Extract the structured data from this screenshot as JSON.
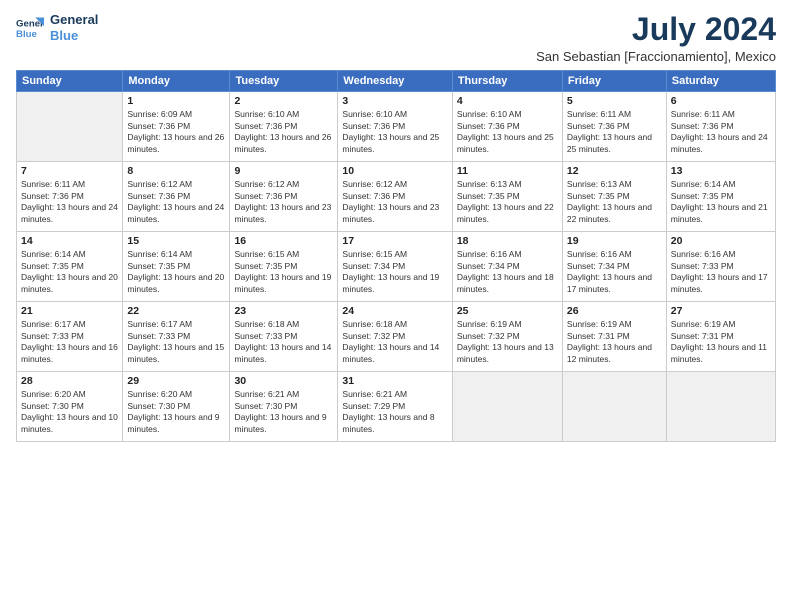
{
  "header": {
    "logo_line1": "General",
    "logo_line2": "Blue",
    "title": "July 2024",
    "subtitle": "San Sebastian [Fraccionamiento], Mexico"
  },
  "calendar": {
    "days_of_week": [
      "Sunday",
      "Monday",
      "Tuesday",
      "Wednesday",
      "Thursday",
      "Friday",
      "Saturday"
    ],
    "weeks": [
      [
        {
          "day": "",
          "sunrise": "",
          "sunset": "",
          "daylight": "",
          "empty": true
        },
        {
          "day": "1",
          "sunrise": "Sunrise: 6:09 AM",
          "sunset": "Sunset: 7:36 PM",
          "daylight": "Daylight: 13 hours and 26 minutes.",
          "empty": false
        },
        {
          "day": "2",
          "sunrise": "Sunrise: 6:10 AM",
          "sunset": "Sunset: 7:36 PM",
          "daylight": "Daylight: 13 hours and 26 minutes.",
          "empty": false
        },
        {
          "day": "3",
          "sunrise": "Sunrise: 6:10 AM",
          "sunset": "Sunset: 7:36 PM",
          "daylight": "Daylight: 13 hours and 25 minutes.",
          "empty": false
        },
        {
          "day": "4",
          "sunrise": "Sunrise: 6:10 AM",
          "sunset": "Sunset: 7:36 PM",
          "daylight": "Daylight: 13 hours and 25 minutes.",
          "empty": false
        },
        {
          "day": "5",
          "sunrise": "Sunrise: 6:11 AM",
          "sunset": "Sunset: 7:36 PM",
          "daylight": "Daylight: 13 hours and 25 minutes.",
          "empty": false
        },
        {
          "day": "6",
          "sunrise": "Sunrise: 6:11 AM",
          "sunset": "Sunset: 7:36 PM",
          "daylight": "Daylight: 13 hours and 24 minutes.",
          "empty": false
        }
      ],
      [
        {
          "day": "7",
          "sunrise": "Sunrise: 6:11 AM",
          "sunset": "Sunset: 7:36 PM",
          "daylight": "Daylight: 13 hours and 24 minutes.",
          "empty": false
        },
        {
          "day": "8",
          "sunrise": "Sunrise: 6:12 AM",
          "sunset": "Sunset: 7:36 PM",
          "daylight": "Daylight: 13 hours and 24 minutes.",
          "empty": false
        },
        {
          "day": "9",
          "sunrise": "Sunrise: 6:12 AM",
          "sunset": "Sunset: 7:36 PM",
          "daylight": "Daylight: 13 hours and 23 minutes.",
          "empty": false
        },
        {
          "day": "10",
          "sunrise": "Sunrise: 6:12 AM",
          "sunset": "Sunset: 7:36 PM",
          "daylight": "Daylight: 13 hours and 23 minutes.",
          "empty": false
        },
        {
          "day": "11",
          "sunrise": "Sunrise: 6:13 AM",
          "sunset": "Sunset: 7:35 PM",
          "daylight": "Daylight: 13 hours and 22 minutes.",
          "empty": false
        },
        {
          "day": "12",
          "sunrise": "Sunrise: 6:13 AM",
          "sunset": "Sunset: 7:35 PM",
          "daylight": "Daylight: 13 hours and 22 minutes.",
          "empty": false
        },
        {
          "day": "13",
          "sunrise": "Sunrise: 6:14 AM",
          "sunset": "Sunset: 7:35 PM",
          "daylight": "Daylight: 13 hours and 21 minutes.",
          "empty": false
        }
      ],
      [
        {
          "day": "14",
          "sunrise": "Sunrise: 6:14 AM",
          "sunset": "Sunset: 7:35 PM",
          "daylight": "Daylight: 13 hours and 20 minutes.",
          "empty": false
        },
        {
          "day": "15",
          "sunrise": "Sunrise: 6:14 AM",
          "sunset": "Sunset: 7:35 PM",
          "daylight": "Daylight: 13 hours and 20 minutes.",
          "empty": false
        },
        {
          "day": "16",
          "sunrise": "Sunrise: 6:15 AM",
          "sunset": "Sunset: 7:35 PM",
          "daylight": "Daylight: 13 hours and 19 minutes.",
          "empty": false
        },
        {
          "day": "17",
          "sunrise": "Sunrise: 6:15 AM",
          "sunset": "Sunset: 7:34 PM",
          "daylight": "Daylight: 13 hours and 19 minutes.",
          "empty": false
        },
        {
          "day": "18",
          "sunrise": "Sunrise: 6:16 AM",
          "sunset": "Sunset: 7:34 PM",
          "daylight": "Daylight: 13 hours and 18 minutes.",
          "empty": false
        },
        {
          "day": "19",
          "sunrise": "Sunrise: 6:16 AM",
          "sunset": "Sunset: 7:34 PM",
          "daylight": "Daylight: 13 hours and 17 minutes.",
          "empty": false
        },
        {
          "day": "20",
          "sunrise": "Sunrise: 6:16 AM",
          "sunset": "Sunset: 7:33 PM",
          "daylight": "Daylight: 13 hours and 17 minutes.",
          "empty": false
        }
      ],
      [
        {
          "day": "21",
          "sunrise": "Sunrise: 6:17 AM",
          "sunset": "Sunset: 7:33 PM",
          "daylight": "Daylight: 13 hours and 16 minutes.",
          "empty": false
        },
        {
          "day": "22",
          "sunrise": "Sunrise: 6:17 AM",
          "sunset": "Sunset: 7:33 PM",
          "daylight": "Daylight: 13 hours and 15 minutes.",
          "empty": false
        },
        {
          "day": "23",
          "sunrise": "Sunrise: 6:18 AM",
          "sunset": "Sunset: 7:33 PM",
          "daylight": "Daylight: 13 hours and 14 minutes.",
          "empty": false
        },
        {
          "day": "24",
          "sunrise": "Sunrise: 6:18 AM",
          "sunset": "Sunset: 7:32 PM",
          "daylight": "Daylight: 13 hours and 14 minutes.",
          "empty": false
        },
        {
          "day": "25",
          "sunrise": "Sunrise: 6:19 AM",
          "sunset": "Sunset: 7:32 PM",
          "daylight": "Daylight: 13 hours and 13 minutes.",
          "empty": false
        },
        {
          "day": "26",
          "sunrise": "Sunrise: 6:19 AM",
          "sunset": "Sunset: 7:31 PM",
          "daylight": "Daylight: 13 hours and 12 minutes.",
          "empty": false
        },
        {
          "day": "27",
          "sunrise": "Sunrise: 6:19 AM",
          "sunset": "Sunset: 7:31 PM",
          "daylight": "Daylight: 13 hours and 11 minutes.",
          "empty": false
        }
      ],
      [
        {
          "day": "28",
          "sunrise": "Sunrise: 6:20 AM",
          "sunset": "Sunset: 7:30 PM",
          "daylight": "Daylight: 13 hours and 10 minutes.",
          "empty": false
        },
        {
          "day": "29",
          "sunrise": "Sunrise: 6:20 AM",
          "sunset": "Sunset: 7:30 PM",
          "daylight": "Daylight: 13 hours and 9 minutes.",
          "empty": false
        },
        {
          "day": "30",
          "sunrise": "Sunrise: 6:21 AM",
          "sunset": "Sunset: 7:30 PM",
          "daylight": "Daylight: 13 hours and 9 minutes.",
          "empty": false
        },
        {
          "day": "31",
          "sunrise": "Sunrise: 6:21 AM",
          "sunset": "Sunset: 7:29 PM",
          "daylight": "Daylight: 13 hours and 8 minutes.",
          "empty": false
        },
        {
          "day": "",
          "sunrise": "",
          "sunset": "",
          "daylight": "",
          "empty": true
        },
        {
          "day": "",
          "sunrise": "",
          "sunset": "",
          "daylight": "",
          "empty": true
        },
        {
          "day": "",
          "sunrise": "",
          "sunset": "",
          "daylight": "",
          "empty": true
        }
      ]
    ]
  }
}
